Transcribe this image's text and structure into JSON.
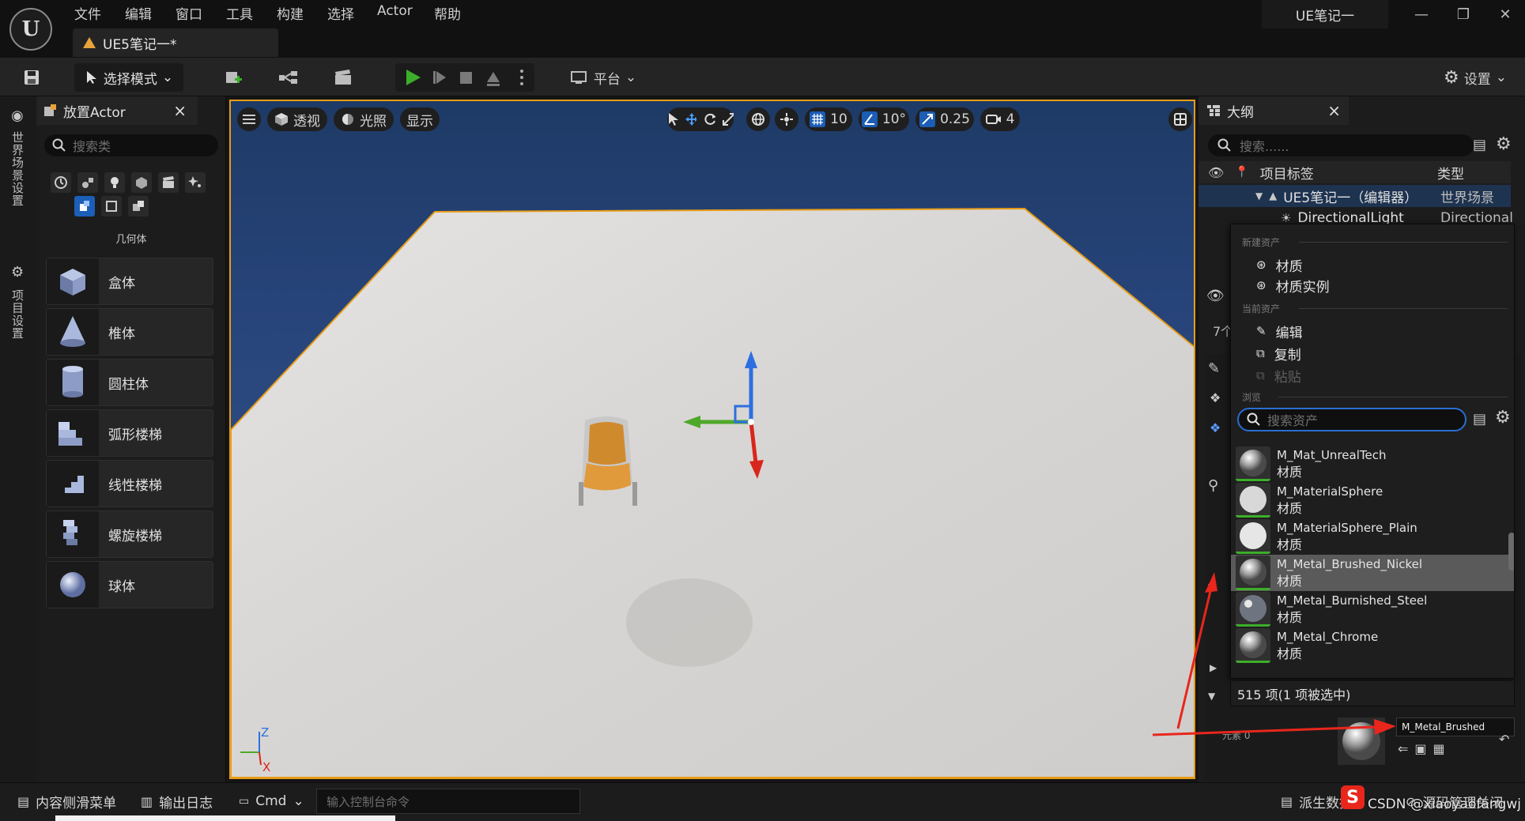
{
  "app": {
    "menu": [
      "文件",
      "编辑",
      "窗口",
      "工具",
      "构建",
      "选择",
      "Actor",
      "帮助"
    ],
    "doc_tab": "UE5笔记一*",
    "project_name": "UE笔记一",
    "window_controls": [
      "—",
      "❐",
      "✕"
    ]
  },
  "toolbar": {
    "mode_label": "选择模式",
    "platform_label": "平台",
    "settings_label": "设置"
  },
  "left_strip": {
    "world_settings": "世界场景设置",
    "project_settings": "项目设置"
  },
  "place_actor": {
    "title": "放置Actor",
    "close": "×",
    "search_placeholder": "搜索类",
    "category_label": "几何体",
    "items": [
      {
        "label": "盒体",
        "icon": "cube-icon"
      },
      {
        "label": "椎体",
        "icon": "cone-icon"
      },
      {
        "label": "圆柱体",
        "icon": "cylinder-icon"
      },
      {
        "label": "弧形楼梯",
        "icon": "curved-stairs-icon"
      },
      {
        "label": "线性楼梯",
        "icon": "linear-stairs-icon"
      },
      {
        "label": "螺旋楼梯",
        "icon": "spiral-stairs-icon"
      },
      {
        "label": "球体",
        "icon": "sphere-icon"
      }
    ]
  },
  "viewport": {
    "perspective": "透视",
    "lighting": "光照",
    "show": "显示",
    "grid_snap": "10",
    "rot_snap": "10°",
    "scale_snap": "0.25",
    "camera_speed": "4",
    "axis_z": "Z",
    "axis_x": "X"
  },
  "outliner": {
    "title": "大纲",
    "close": "×",
    "search_placeholder": "搜索......",
    "col_label": "项目标签",
    "col_type": "类型",
    "rows": [
      {
        "label": "UE5笔记一（编辑器）",
        "type": "世界场景"
      },
      {
        "label": "DirectionalLight",
        "type": "Directional"
      }
    ],
    "count_fragment": "7个"
  },
  "context_menu": {
    "new_asset_section": "新建资产",
    "material": "材质",
    "material_instance": "材质实例",
    "current_asset_section": "当前资产",
    "edit": "编辑",
    "copy": "复制",
    "paste": "粘贴",
    "browse_section": "浏览",
    "search_placeholder": "搜索资产",
    "assets": [
      {
        "name": "M_Mat_UnrealTech",
        "type": "材质"
      },
      {
        "name": "M_MaterialSphere",
        "type": "材质"
      },
      {
        "name": "M_MaterialSphere_Plain",
        "type": "材质"
      },
      {
        "name": "M_Metal_Brushed_Nickel",
        "type": "材质",
        "selected": true
      },
      {
        "name": "M_Metal_Burnished_Steel",
        "type": "材质"
      },
      {
        "name": "M_Metal_Chrome",
        "type": "材质"
      }
    ],
    "count": "515 项(1 项被选中)"
  },
  "details": {
    "element_label": "元素 0",
    "slot_value": "M_Metal_Brushed"
  },
  "bottombar": {
    "content_drawer": "内容侧滑菜单",
    "output_log": "输出日志",
    "cmd": "Cmd",
    "console_placeholder": "输入控制台命令",
    "derived_data": "派生数据",
    "source_control": "源码管理关闭"
  },
  "watermark": "CSDN @xiaoyaofangwj",
  "colors": {
    "accent_blue": "#1c5db5",
    "selection_orange": "#e69c17",
    "play_green": "#3dae2b",
    "annotation_red": "#e8261c"
  }
}
